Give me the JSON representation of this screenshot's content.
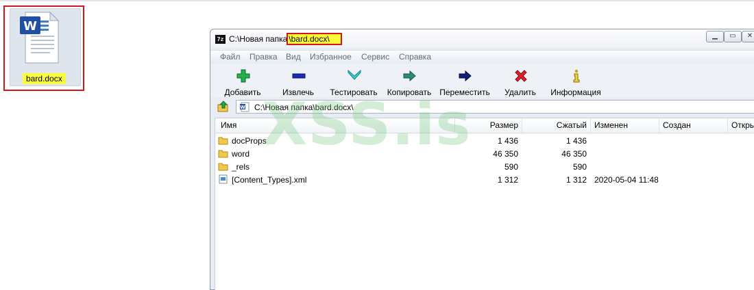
{
  "desktop": {
    "file_label": "bard.docx"
  },
  "window": {
    "app_icon_text": "7z",
    "title_prefix": "C:\\Новая папка",
    "title_highlight": "\\bard.docx\\",
    "buttons": [
      "minimize-icon",
      "maximize-icon",
      "close-icon"
    ]
  },
  "menu": [
    "Файл",
    "Правка",
    "Вид",
    "Избранное",
    "Сервис",
    "Справка"
  ],
  "toolbar": [
    {
      "label": "Добавить",
      "icon": "plus-icon",
      "color": "#22b14c"
    },
    {
      "label": "Извлечь",
      "icon": "minus-icon",
      "color": "#1a2bbf"
    },
    {
      "label": "Тестировать",
      "icon": "check-icon",
      "color": "#3fc9c9"
    },
    {
      "label": "Копировать",
      "icon": "copy-arrow-icon",
      "color": "#2e8b74"
    },
    {
      "label": "Переместить",
      "icon": "move-arrow-icon",
      "color": "#13207a"
    },
    {
      "label": "Удалить",
      "icon": "delete-icon",
      "color": "#e0202a"
    },
    {
      "label": "Информация",
      "icon": "info-icon",
      "color": "#c9a400"
    }
  ],
  "address": {
    "path": "C:\\Новая папка\\bard.docx\\"
  },
  "columns": [
    "Имя",
    "Размер",
    "Сжатый",
    "Изменен",
    "Создан",
    "Откры"
  ],
  "rows": [
    {
      "name": "docProps",
      "size": "1 436",
      "packed": "1 436",
      "modified": "",
      "type": "folder"
    },
    {
      "name": "word",
      "size": "46 350",
      "packed": "46 350",
      "modified": "",
      "type": "folder"
    },
    {
      "name": "_rels",
      "size": "590",
      "packed": "590",
      "modified": "",
      "type": "folder"
    },
    {
      "name": "[Content_Types].xml",
      "size": "1 312",
      "packed": "1 312",
      "modified": "2020-05-04 11:48",
      "type": "xml"
    }
  ],
  "watermark": "XSS.is"
}
